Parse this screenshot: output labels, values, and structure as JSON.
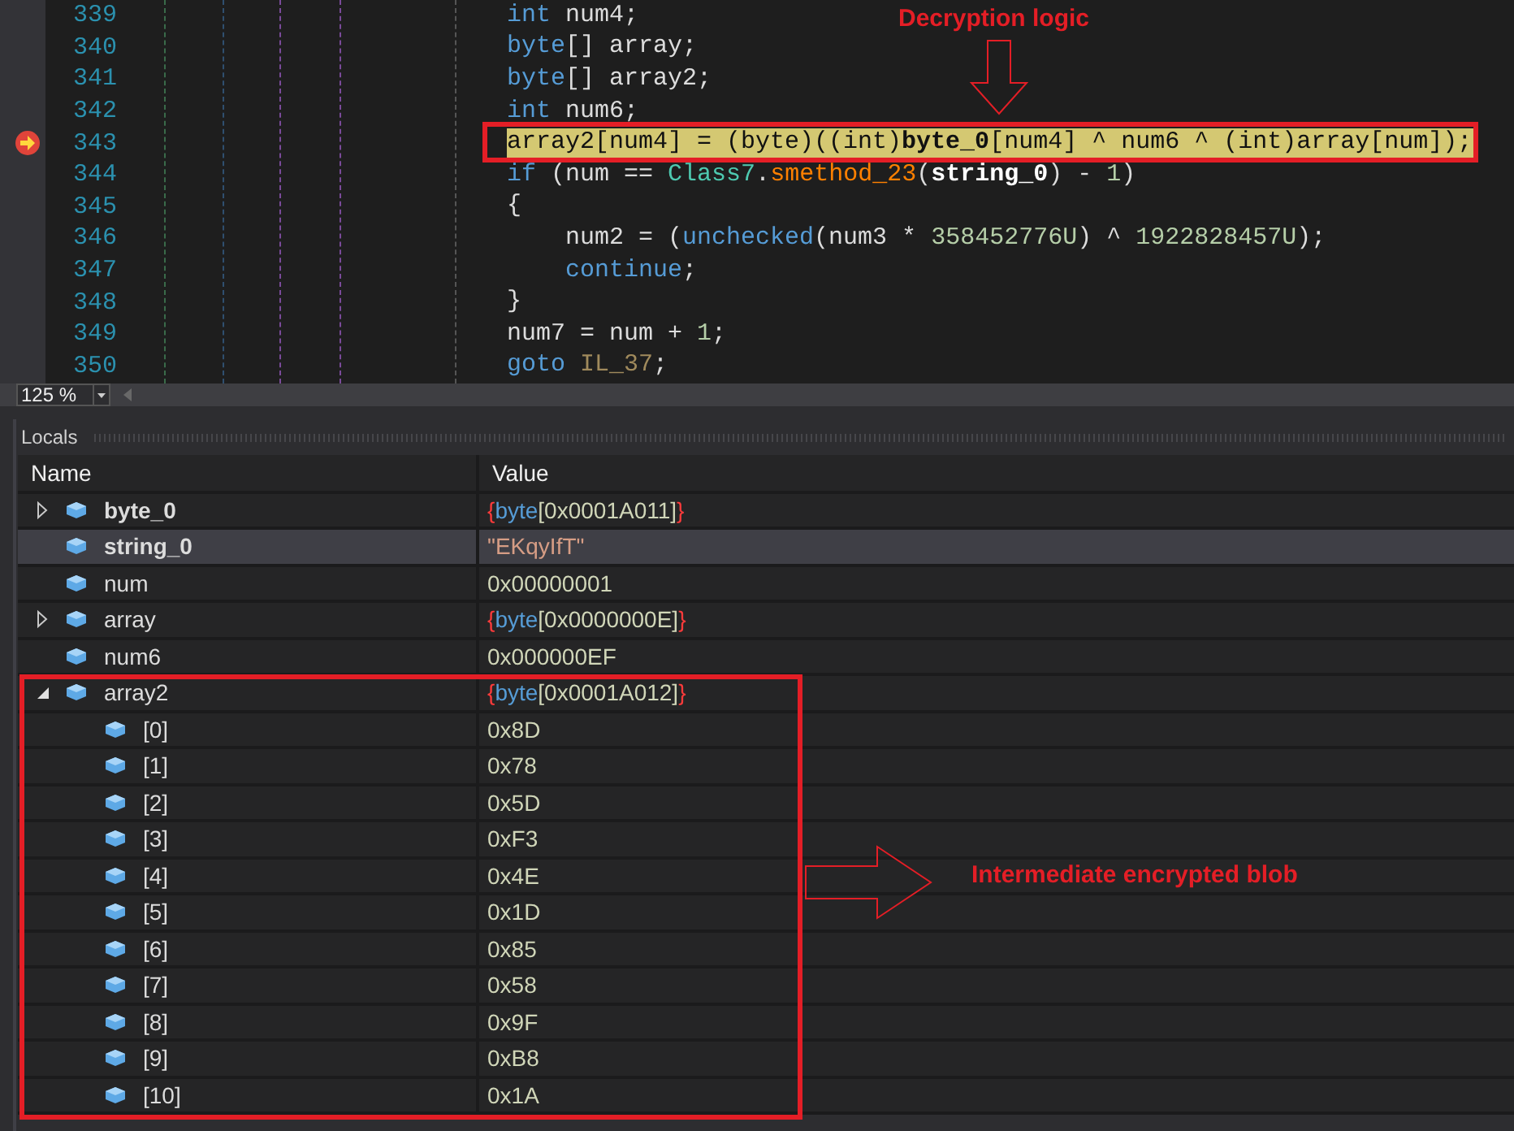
{
  "editor": {
    "zoom": "125 %",
    "lines": [
      {
        "number": "339",
        "current": false,
        "tokens": [
          {
            "text": "int",
            "kind": "keyword"
          },
          {
            "text": " num4;",
            "kind": "plain"
          }
        ]
      },
      {
        "number": "340",
        "current": false,
        "tokens": [
          {
            "text": "byte",
            "kind": "keyword"
          },
          {
            "text": "[] array;",
            "kind": "plain"
          }
        ]
      },
      {
        "number": "341",
        "current": false,
        "tokens": [
          {
            "text": "byte",
            "kind": "keyword"
          },
          {
            "text": "[] array2;",
            "kind": "plain"
          }
        ]
      },
      {
        "number": "342",
        "current": false,
        "tokens": [
          {
            "text": "int",
            "kind": "keyword"
          },
          {
            "text": " num6;",
            "kind": "plain"
          }
        ]
      },
      {
        "number": "343",
        "current": true,
        "tokens": [
          {
            "text": "array2[num4] = (byte)((int)",
            "kind": "plain"
          },
          {
            "text": "byte_0",
            "kind": "field"
          },
          {
            "text": "[num4] ^ num6 ^ (int)array[num]);",
            "kind": "plain"
          }
        ]
      },
      {
        "number": "344",
        "current": false,
        "tokens": [
          {
            "text": "if",
            "kind": "keyword"
          },
          {
            "text": " (num == ",
            "kind": "plain"
          },
          {
            "text": "Class7",
            "kind": "class"
          },
          {
            "text": ".",
            "kind": "plain"
          },
          {
            "text": "smethod_23",
            "kind": "method"
          },
          {
            "text": "(",
            "kind": "plain"
          },
          {
            "text": "string_0",
            "kind": "field"
          },
          {
            "text": ") - ",
            "kind": "plain"
          },
          {
            "text": "1",
            "kind": "number"
          },
          {
            "text": ")",
            "kind": "plain"
          }
        ]
      },
      {
        "number": "345",
        "current": false,
        "tokens": [
          {
            "text": "{",
            "kind": "plain"
          }
        ]
      },
      {
        "number": "346",
        "current": false,
        "tokens": [
          {
            "text": "    num2 = (",
            "kind": "plain"
          },
          {
            "text": "unchecked",
            "kind": "keyword"
          },
          {
            "text": "(num3 * ",
            "kind": "plain"
          },
          {
            "text": "358452776U",
            "kind": "number"
          },
          {
            "text": ") ^ ",
            "kind": "plain"
          },
          {
            "text": "1922828457U",
            "kind": "number"
          },
          {
            "text": ");",
            "kind": "plain"
          }
        ]
      },
      {
        "number": "347",
        "current": false,
        "tokens": [
          {
            "text": "    continue",
            "kind": "keyword"
          },
          {
            "text": ";",
            "kind": "plain"
          }
        ]
      },
      {
        "number": "348",
        "current": false,
        "tokens": [
          {
            "text": "}",
            "kind": "plain"
          }
        ]
      },
      {
        "number": "349",
        "current": false,
        "tokens": [
          {
            "text": "num7 = num + ",
            "kind": "plain"
          },
          {
            "text": "1",
            "kind": "number"
          },
          {
            "text": ";",
            "kind": "plain"
          }
        ]
      },
      {
        "number": "350",
        "current": false,
        "tokens": [
          {
            "text": "goto ",
            "kind": "keyword"
          },
          {
            "text": "IL_37",
            "kind": "label"
          },
          {
            "text": ";",
            "kind": "plain"
          }
        ]
      }
    ]
  },
  "locals": {
    "title": "Locals",
    "columns": [
      "Name",
      "Value"
    ],
    "rows": [
      {
        "name": "byte_0",
        "bold": true,
        "expanded": false,
        "selected": false,
        "value": [
          {
            "text": "{",
            "kind": "brace"
          },
          {
            "text": "byte",
            "kind": "type"
          },
          {
            "text": "[0x0001A011]",
            "kind": "plain"
          },
          {
            "text": "}",
            "kind": "brace"
          }
        ]
      },
      {
        "name": "string_0",
        "bold": true,
        "selected": true,
        "value": [
          {
            "text": "\"EKqyIfT\"",
            "kind": "string"
          }
        ]
      },
      {
        "name": "num",
        "bold": false,
        "selected": false,
        "value": [
          {
            "text": "0x00000001",
            "kind": "plain"
          }
        ]
      },
      {
        "name": "array",
        "bold": false,
        "expanded": false,
        "selected": false,
        "value": [
          {
            "text": "{",
            "kind": "brace"
          },
          {
            "text": "byte",
            "kind": "type"
          },
          {
            "text": "[0x0000000E]",
            "kind": "plain"
          },
          {
            "text": "}",
            "kind": "brace"
          }
        ]
      },
      {
        "name": "num6",
        "bold": false,
        "selected": false,
        "value": [
          {
            "text": "0x000000EF",
            "kind": "plain"
          }
        ]
      },
      {
        "name": "array2",
        "bold": false,
        "expanded": true,
        "selected": false,
        "value": [
          {
            "text": "{",
            "kind": "brace"
          },
          {
            "text": "byte",
            "kind": "type"
          },
          {
            "text": "[0x0001A012]",
            "kind": "plain"
          },
          {
            "text": "}",
            "kind": "brace"
          }
        ],
        "children": [
          {
            "name": "[0]",
            "selected": false,
            "value": [
              {
                "text": "0x8D",
                "kind": "plain"
              }
            ]
          },
          {
            "name": "[1]",
            "selected": false,
            "value": [
              {
                "text": "0x78",
                "kind": "plain"
              }
            ]
          },
          {
            "name": "[2]",
            "selected": false,
            "value": [
              {
                "text": "0x5D",
                "kind": "plain"
              }
            ]
          },
          {
            "name": "[3]",
            "selected": false,
            "value": [
              {
                "text": "0xF3",
                "kind": "plain"
              }
            ]
          },
          {
            "name": "[4]",
            "selected": false,
            "value": [
              {
                "text": "0x4E",
                "kind": "plain"
              }
            ]
          },
          {
            "name": "[5]",
            "selected": false,
            "value": [
              {
                "text": "0x1D",
                "kind": "plain"
              }
            ]
          },
          {
            "name": "[6]",
            "selected": false,
            "value": [
              {
                "text": "0x85",
                "kind": "plain"
              }
            ]
          },
          {
            "name": "[7]",
            "selected": false,
            "value": [
              {
                "text": "0x58",
                "kind": "plain"
              }
            ]
          },
          {
            "name": "[8]",
            "selected": false,
            "value": [
              {
                "text": "0x9F",
                "kind": "plain"
              }
            ]
          },
          {
            "name": "[9]",
            "selected": false,
            "value": [
              {
                "text": "0xB8",
                "kind": "plain"
              }
            ]
          },
          {
            "name": "[10]",
            "selected": false,
            "value": [
              {
                "text": "0x1A",
                "kind": "plain"
              }
            ]
          }
        ]
      }
    ]
  },
  "annotations": [
    {
      "kind": "code",
      "text": "Decryption logic"
    },
    {
      "kind": "locals",
      "text": "Intermediate encrypted blob"
    }
  ]
}
